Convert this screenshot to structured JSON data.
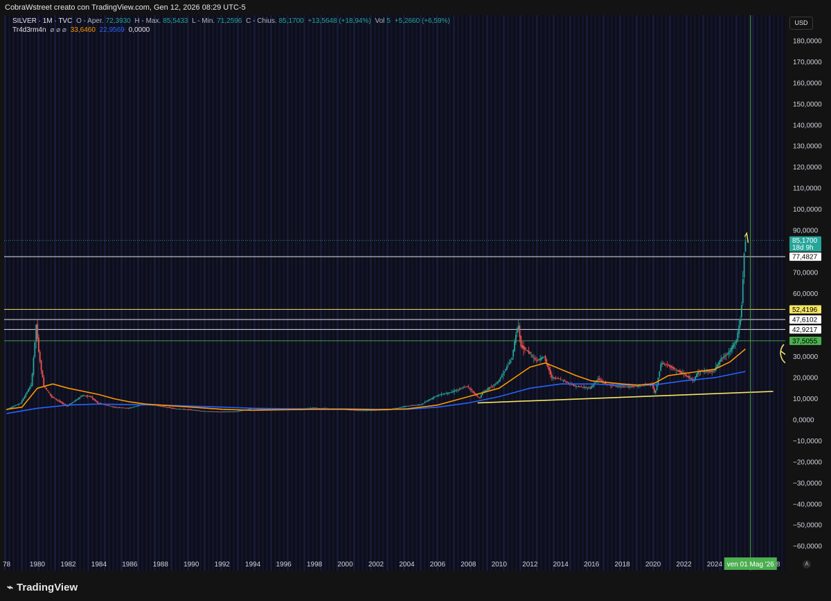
{
  "header": {
    "title": "CobraWstreet creato con TradingView.com, Gen 12, 2026 08:29 UTC-5"
  },
  "legend": {
    "symbol": "SILVER · 1M · TVC",
    "open_label": "O - Aper.",
    "open": "72,3930",
    "high_label": "H - Max.",
    "high": "85,5433",
    "low_label": "L - Min.",
    "low": "71,2596",
    "close_label": "C - Chius.",
    "close": "85,1700",
    "change": "+13,5648 (+18,94%)",
    "vol_label": "Vol",
    "vol": "5",
    "vol_change": "+5,2660 (+6,59%)",
    "indicator": "Tr4d3rm4n",
    "indicator_flags": "⌀ ⌀ ⌀",
    "ind_v1": "33,6460",
    "ind_v2": "22,9569",
    "ind_v3": "0,0000"
  },
  "currency": "USD",
  "footer": {
    "brand": "TradingView",
    "brand_icon": "tradingview-logo-icon",
    "auto_button": "A"
  },
  "colors": {
    "up": "#26a69a",
    "down": "#ef5350",
    "ma_fast": "#ff9800",
    "ma_slow": "#2962ff",
    "level_yellow": "#f5e663",
    "level_white": "#e6e6e6",
    "level_green": "#4caf50",
    "cursor": "#4caf50"
  },
  "chart_data": {
    "type": "candlestick",
    "symbol": "SILVER",
    "timeframe": "1M",
    "x_range": [
      1978,
      2028
    ],
    "y_range": [
      -65000,
      190000
    ],
    "x_ticks": [
      "78",
      "1980",
      "1982",
      "1984",
      "1986",
      "1988",
      "1990",
      "1992",
      "1994",
      "1996",
      "1998",
      "2000",
      "2002",
      "2004",
      "2006",
      "2008",
      "2010",
      "2012",
      "2014",
      "2016",
      "2018",
      "2020",
      "2022",
      "2024",
      "28"
    ],
    "y_ticks": [
      180000,
      170000,
      160000,
      150000,
      140000,
      130000,
      120000,
      110000,
      100000,
      90000,
      70000,
      60000,
      30000,
      20000,
      10000,
      0,
      -10000,
      -20000,
      -30000,
      -40000,
      -50000,
      -60000
    ],
    "y_tick_labels": [
      "180,0000",
      "170,0000",
      "160,0000",
      "150,0000",
      "140,0000",
      "130,0000",
      "120,0000",
      "110,0000",
      "100,0000",
      "90,0000",
      "70,0000",
      "60,0000",
      "30,0000",
      "20,0000",
      "10,0000",
      "0,0000",
      "−10,0000",
      "−20,0000",
      "−30,0000",
      "−40,0000",
      "−50,0000",
      "−60,0000"
    ],
    "price_path": [
      [
        1978,
        4.6
      ],
      [
        1979,
        8
      ],
      [
        1979.7,
        17
      ],
      [
        1980,
        45
      ],
      [
        1980.2,
        30
      ],
      [
        1980.5,
        16
      ],
      [
        1981,
        11
      ],
      [
        1982,
        6.5
      ],
      [
        1983,
        11.5
      ],
      [
        1983.5,
        11.2
      ],
      [
        1984,
        8
      ],
      [
        1985,
        6.1
      ],
      [
        1986,
        5.5
      ],
      [
        1987,
        7.5
      ],
      [
        1988,
        6.6
      ],
      [
        1989,
        5.3
      ],
      [
        1990,
        4.8
      ],
      [
        1991,
        4
      ],
      [
        1992,
        3.8
      ],
      [
        1993,
        3.9
      ],
      [
        1994,
        5.3
      ],
      [
        1995,
        5
      ],
      [
        1996,
        5
      ],
      [
        1997,
        4.8
      ],
      [
        1998,
        5.7
      ],
      [
        1999,
        5.3
      ],
      [
        2000,
        5
      ],
      [
        2001,
        4.4
      ],
      [
        2002,
        4.6
      ],
      [
        2003,
        4.8
      ],
      [
        2004,
        6.5
      ],
      [
        2005,
        7.2
      ],
      [
        2006,
        11.5
      ],
      [
        2007,
        13.2
      ],
      [
        2008,
        16
      ],
      [
        2008.8,
        10
      ],
      [
        2009,
        13
      ],
      [
        2010,
        18
      ],
      [
        2010.9,
        29
      ],
      [
        2011.3,
        46
      ],
      [
        2011.5,
        35
      ],
      [
        2012,
        32
      ],
      [
        2012.5,
        28
      ],
      [
        2013,
        30
      ],
      [
        2013.5,
        20
      ],
      [
        2014,
        19.5
      ],
      [
        2015,
        16
      ],
      [
        2016,
        15
      ],
      [
        2016.5,
        19.5
      ],
      [
        2017,
        17
      ],
      [
        2018,
        15.5
      ],
      [
        2019,
        16
      ],
      [
        2020,
        17
      ],
      [
        2020.2,
        12
      ],
      [
        2020.6,
        27
      ],
      [
        2021,
        26
      ],
      [
        2022,
        22
      ],
      [
        2022.7,
        18.5
      ],
      [
        2023,
        23
      ],
      [
        2024,
        23
      ],
      [
        2024.5,
        29
      ],
      [
        2025,
        32
      ],
      [
        2025.5,
        38
      ],
      [
        2025.8,
        50
      ],
      [
        2025.95,
        72
      ],
      [
        2026.04,
        85.17
      ]
    ],
    "ma_fast": [
      [
        1978,
        5
      ],
      [
        1979,
        6
      ],
      [
        1980,
        15
      ],
      [
        1981,
        17
      ],
      [
        1982,
        15
      ],
      [
        1983,
        13.5
      ],
      [
        1984,
        12
      ],
      [
        1985,
        10
      ],
      [
        1986,
        8.5
      ],
      [
        1987,
        7.5
      ],
      [
        1988,
        7
      ],
      [
        1990,
        6
      ],
      [
        1992,
        5
      ],
      [
        1994,
        4.5
      ],
      [
        1996,
        4.8
      ],
      [
        1998,
        5
      ],
      [
        2000,
        5
      ],
      [
        2002,
        4.8
      ],
      [
        2004,
        5.2
      ],
      [
        2006,
        7
      ],
      [
        2008,
        11
      ],
      [
        2010,
        15
      ],
      [
        2011,
        20
      ],
      [
        2012,
        25
      ],
      [
        2013,
        27
      ],
      [
        2014,
        24
      ],
      [
        2015,
        21
      ],
      [
        2016,
        18.5
      ],
      [
        2018,
        17
      ],
      [
        2019,
        16.5
      ],
      [
        2020,
        17
      ],
      [
        2021,
        21
      ],
      [
        2022,
        22
      ],
      [
        2023,
        23
      ],
      [
        2024,
        24
      ],
      [
        2025,
        27.5
      ],
      [
        2026,
        33.646
      ]
    ],
    "ma_slow": [
      [
        1978,
        3
      ],
      [
        1980,
        5.5
      ],
      [
        1982,
        7
      ],
      [
        1984,
        7.5
      ],
      [
        1986,
        7.2
      ],
      [
        1988,
        7
      ],
      [
        1990,
        6.5
      ],
      [
        1992,
        6
      ],
      [
        1994,
        5.5
      ],
      [
        1996,
        5.3
      ],
      [
        1998,
        5.2
      ],
      [
        2000,
        5.2
      ],
      [
        2002,
        5
      ],
      [
        2004,
        5
      ],
      [
        2006,
        6
      ],
      [
        2008,
        8
      ],
      [
        2010,
        11
      ],
      [
        2012,
        15
      ],
      [
        2014,
        17
      ],
      [
        2016,
        17
      ],
      [
        2018,
        16.5
      ],
      [
        2020,
        16.5
      ],
      [
        2022,
        18.5
      ],
      [
        2024,
        20
      ],
      [
        2026,
        22.9569
      ]
    ],
    "trendline": [
      [
        2008.6,
        8
      ],
      [
        2027.8,
        13.5
      ]
    ],
    "horizontal_levels": [
      {
        "value": 77.4827,
        "label": "77,4827",
        "color": "white"
      },
      {
        "value": 52.4196,
        "label": "52,4196",
        "color": "yellow"
      },
      {
        "value": 47.6102,
        "label": "47,6102",
        "color": "white"
      },
      {
        "value": 42.9217,
        "label": "42,9217",
        "color": "white"
      },
      {
        "value": 37.5055,
        "label": "37,5055",
        "color": "green"
      }
    ],
    "last_price": {
      "value": 85.17,
      "label": "85,1700",
      "countdown": "18d 9h"
    },
    "cursor": {
      "x": 2026.33,
      "label": "ven 01 Mag '26"
    },
    "grid": false,
    "background": "vertical-stripes"
  }
}
